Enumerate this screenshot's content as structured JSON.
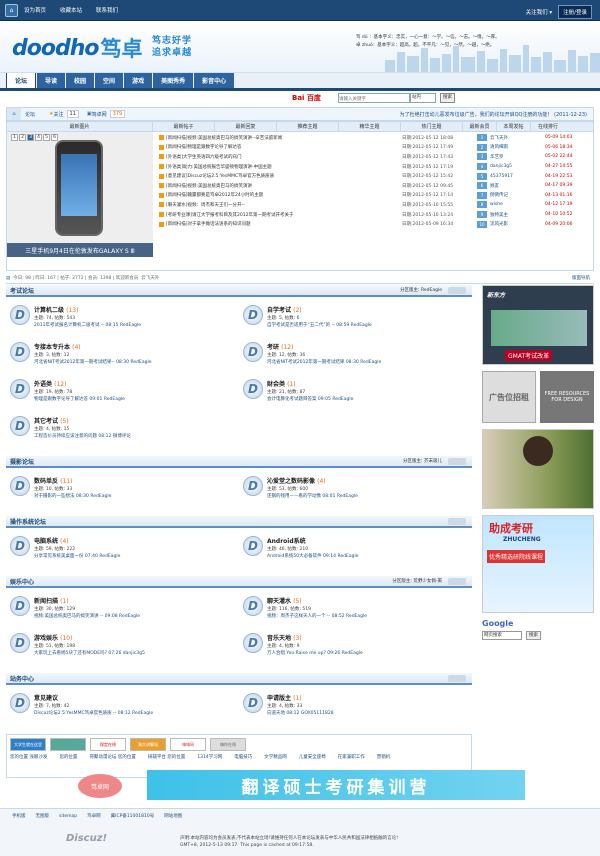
{
  "topbar": {
    "home_icon": "home-icon",
    "set_home": "设为首页",
    "bookmark": "收藏本站",
    "contact": "联系我们",
    "follow": "关注我们 ▾",
    "login": "注册/登录"
  },
  "header": {
    "logo_en": "doodho",
    "logo_cn": "笃卓",
    "slogan1": "笃志好学",
    "slogan2": "追求卓越",
    "dict1": "笃 dǔ ：基本字义：忠实，一心一意：～学。～信。～志。～情。～厚。",
    "dict2": "卓 zhuó：基本字义：超高，超，不平凡：～见，～然，～越，～绝。"
  },
  "nav": [
    "论坛",
    "导读",
    "校园",
    "空间",
    "游戏",
    "美图秀秀",
    "影音中心"
  ],
  "search": {
    "brand": "Bai 百度",
    "placeholder": "请输入关键字",
    "scope": "站内",
    "button": "搜索"
  },
  "crumbs": {
    "forum": "论坛",
    "follow": "关注",
    "follow_count": "11",
    "app": "笃卓网",
    "app_count": "379",
    "notice": "为了杜绝打击幼儿恶发布垃圾广告，我们的论坛开启QQ注册的功能！ (2011-12-23)"
  },
  "hot": {
    "headers": [
      "最新图片",
      "最新帖子",
      "最新回复",
      "推荐主题",
      "精华主题",
      "热门主题",
      "最新会员",
      "本周发帖",
      "在线排行"
    ],
    "photo_nums": [
      "1",
      "2",
      "3",
      "4",
      "5",
      "6"
    ],
    "photo_caption": "三星手机9月4日在伦敦发布GALAXY S Ⅲ",
    "threads": [
      {
        "t": "[新闻扫描]视频:美国总统奥巴马的搞笑演讲--辛苦法庭新闻",
        "d": "日期:2012-05-12 18:08"
      },
      {
        "t": "[新闻扫描]物理是跟数字论导了解达答",
        "d": "日期:2012-05-12 17:49"
      },
      {
        "t": "[外语类]大学生英语四六级考试的窍门",
        "d": "日期:2012-05-12 17:43"
      },
      {
        "t": "[外语类]助力:美国总统报告华盛顿物理演讲-中国主题",
        "d": "日期:2012-05-12 17:19"
      },
      {
        "t": "[意见建议]Discuz论坛2.5:YesMMC笃卓官方色质质质",
        "d": "日期:2012-05-12 15:42"
      },
      {
        "t": "[新闻扫描]视频:美国总统奥巴马的搞笑演讲",
        "d": "日期:2012-05-12 09:45"
      },
      {
        "t": "[新闻扫描]输赢都要是笃卓2012年24小时的主题",
        "d": "日期:2012-05-12 17:14"
      },
      {
        "t": "[聊天灌水]视频：周杰和天王们一分开--",
        "d": "日期:2012-05-10 15:55"
      },
      {
        "t": "[考研专业课]请江大学报考科目及其2012年第一期考试开考关于",
        "d": "日期:2012-05-10 13:24"
      },
      {
        "t": "[新闻扫描]对于拿手做话法语系的知识问题",
        "d": "日期:2012-05-09 16:34"
      }
    ],
    "members": [
      {
        "n": "云飞天外",
        "d": "05-09 14:03"
      },
      {
        "n": "清风细雨",
        "d": "05-06 18:34"
      },
      {
        "n": "华艺罗",
        "d": "05-02 22:44"
      },
      {
        "n": "danjic3g5",
        "d": "04-27 14:55"
      },
      {
        "n": "45375917",
        "d": "04-19 22:53"
      },
      {
        "n": "顾友",
        "d": "04-17 09:39"
      },
      {
        "n": "倒倒传记",
        "d": "04-13 01:16"
      },
      {
        "n": "wishe",
        "d": "04-12 17:19"
      },
      {
        "n": "独特美主",
        "d": "04-10 10:52"
      },
      {
        "n": "流风光影",
        "d": "04-09 20:06"
      }
    ]
  },
  "stats": {
    "text": "今日: 98 | 昨日: 167 | 帖子: 2772 | 会员: 1398 | 欢迎新会员: 云飞天外",
    "right": "版面导航"
  },
  "sections": [
    {
      "title": "考试论坛",
      "mod": "分区版主: RedEagle",
      "boards": [
        {
          "n": "计算机二级",
          "c": "(13)",
          "s": "主题: 74, 帖数: 543",
          "lp": "2011年考试报名计算机二级考试 -- 08:15 RedEagle"
        },
        {
          "n": "自学考试",
          "c": "(2)",
          "s": "主题: 5, 帖数: 6",
          "lp": "自学考试是否适用于“五二代”的 -- 08:59 RedEagle"
        },
        {
          "n": "专接本专升本",
          "c": "(4)",
          "s": "主题: 3, 帖数: 12",
          "lp": "河北省NIT考试2012年第一期考试结果-- 08:30 RedEagle"
        },
        {
          "n": "考研",
          "c": "(12)",
          "s": "主题: 12, 帖数: 36",
          "lp": "河北省NIT考试2012年第一期考试结果 08:30 RedEagle"
        },
        {
          "n": "外语类",
          "c": "(12)",
          "s": "主题: 19, 帖数: 78",
          "lp": "物理是跟数字论导了解达答 09:01 RedEagle"
        },
        {
          "n": "财会类",
          "c": "(1)",
          "s": "主题: 21, 帖数: 87",
          "lp": "会计电算化考试题目答案 09:05 RedEagle"
        },
        {
          "n": "其它考试",
          "c": "(5)",
          "s": "主题: 4, 帖数: 15",
          "lp": "工程造价员持续应该注意的问题 08:12 微博评论"
        }
      ]
    },
    {
      "title": "摄影论坛",
      "mod": "分区版主: 芥末吸儿",
      "boards": [
        {
          "n": "数码单反",
          "c": "(11)",
          "s": "主题: 10, 帖数: 33",
          "lp": "对于摄影的一些想法 08:30 RedEagle"
        },
        {
          "n": "沁爱堂之数码影像",
          "c": "(4)",
          "s": "主题: 53, 帖数: 600",
          "lp": "还钢的钱用——看的学动像 08:01 RedEagle"
        }
      ]
    },
    {
      "title": "操作系统论坛",
      "mod": "",
      "boards": [
        {
          "n": "电脑系统",
          "c": "(4)",
          "s": "主题: 59, 帖数: 222",
          "lp": "分享常见系统美桌面一份 07:40 RedEagle"
        },
        {
          "n": "Android系统",
          "c": "",
          "s": "主题: 46, 帖数: 210",
          "lp": "Android系统50大必备软件 09:14 RedEagle"
        }
      ]
    },
    {
      "title": "娱乐中心",
      "mod": "分区版主: 荒野少女佩-窦",
      "boards": [
        {
          "n": "新闻扫描",
          "c": "(1)",
          "s": "主题: 30, 帖数: 129",
          "lp": "视频:美国总统奥巴马的搞笑演讲 -- 09:08 RedEagle"
        },
        {
          "n": "聊天灌水",
          "c": "(5)",
          "s": "主题: 116, 帖数: 519",
          "lp": "视频：周杰子这样天人的一个 -- 08:52 RedEagle"
        },
        {
          "n": "游戏娱乐",
          "c": "(10)",
          "s": "主题: 51, 帖数: 198",
          "lp": "大家玩上去看杨5块了还有MODE吗? 07:26 danjic3g5"
        },
        {
          "n": "音乐天地",
          "c": "(3)",
          "s": "主题: 4, 帖数: 9",
          "lp": "万人合唱 You Raise me up? 09:26 RedEagle"
        }
      ]
    },
    {
      "title": "站务中心",
      "mod": "",
      "boards": [
        {
          "n": "意见建议",
          "c": "",
          "s": "主题: 7, 帖数: 42",
          "lp": "Discuz论坛2.5:YesMMC笃卓官色质质 -- 08:12 RedEagle"
        },
        {
          "n": "申请版主",
          "c": "(1)",
          "s": "主题: 4, 帖数: 33",
          "lp": "向道天地 08:12 GOX05111828"
        }
      ]
    }
  ],
  "links": {
    "logos": [
      "大学生就在这里",
      "",
      "保定在线",
      "淘大讲解站",
      "嗨嗨网",
      "嗨你在线"
    ],
    "texts": [
      "您的位置 浅眼沙发",
      "您的位置",
      "哥聚动漫论坛 您的位置",
      "研辅平台 您的位置",
      "1314学习网",
      "电脑技巧",
      "文学精品网",
      "儿童安全座椅",
      "在家兼职工作",
      "营销机"
    ]
  },
  "bottom_ad": {
    "brand": "笃卓网",
    "text": "翻译硕士考研集训营"
  },
  "footer": {
    "links": [
      "手机版",
      "无图版",
      "sitemap",
      "笃卓网",
      "冀ICP备11001810号",
      "网站地图"
    ],
    "copy1": "声明:本站内容均为会员发表,不代表本站立场!请维持任何人在本论坛发表与中华人民共和国法律相抵触的言论!",
    "copy2": "GMT+8, 2012-5-13 09:17. This page is cached at 09:17:58.",
    "disc": "Discuz!"
  },
  "side": {
    "ad1": "GMAT考试改革",
    "ad1b": "新东方",
    "ad2a": "广告位招租",
    "ad2b": "FREE RESOURCES FOR DESIGN",
    "ad4": "助成考研",
    "ad4b": "ZHUCHENG",
    "ad4c": "优秀精选研院线课程",
    "google": "Google",
    "g_opt": "网页搜索",
    "g_btn": "搜索"
  }
}
